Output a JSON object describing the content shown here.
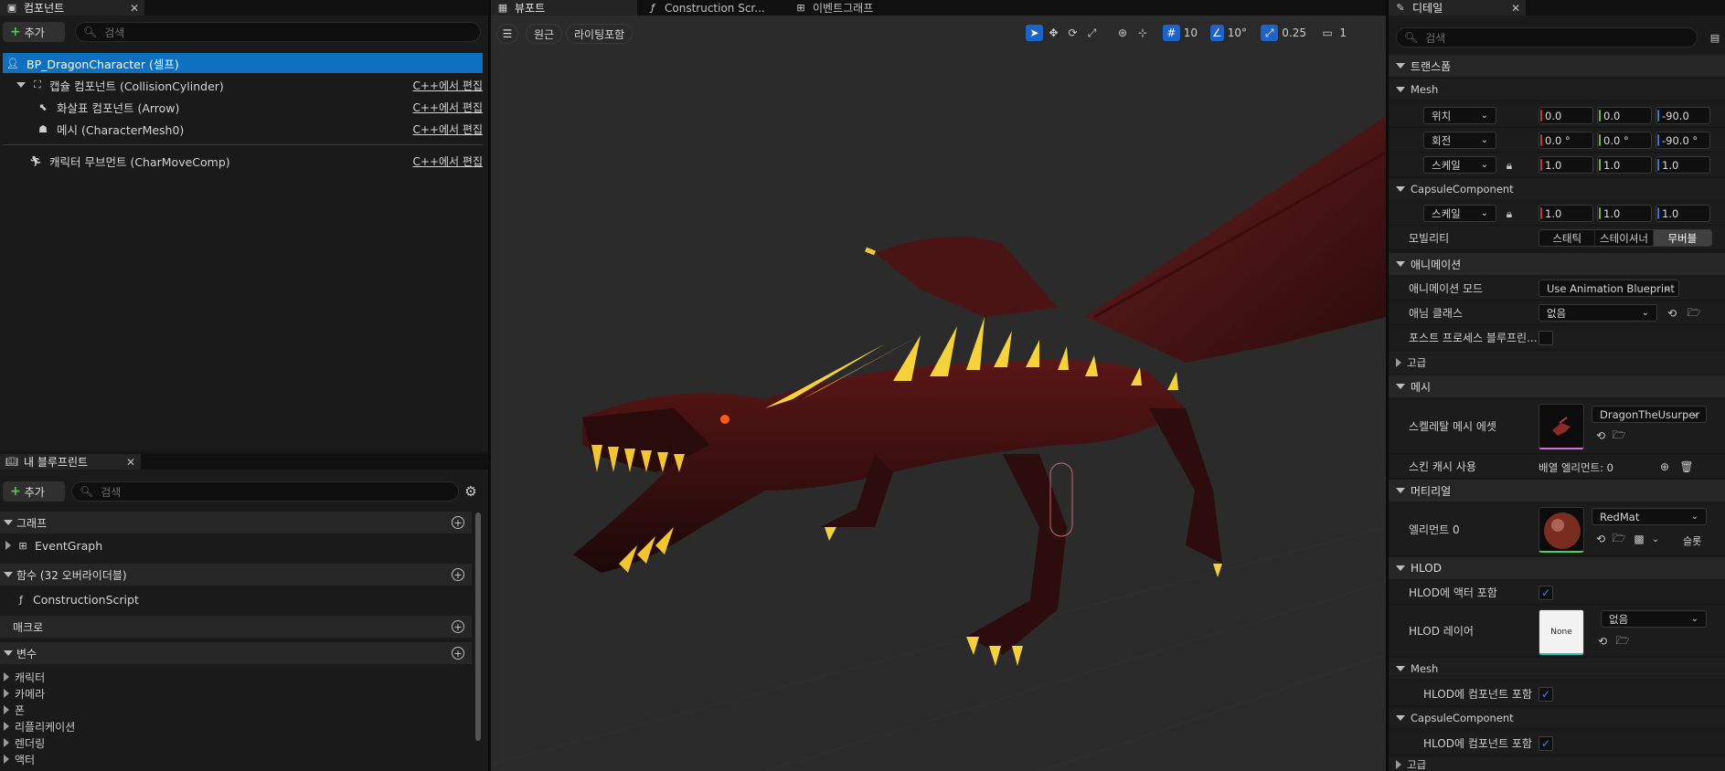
{
  "components": {
    "tab_title": "컴포넌트",
    "add_label": "추가",
    "search_placeholder": "검색",
    "root": "BP_DragonCharacter (셀프)",
    "items": [
      {
        "label": "캡슐 컴포넌트 (CollisionCylinder)",
        "edit": "C++에서 편집"
      },
      {
        "label": "화살표 컴포넌트 (Arrow)",
        "edit": "C++에서 편집"
      },
      {
        "label": "메시 (CharacterMesh0)",
        "edit": "C++에서 편집"
      },
      {
        "label": "캐릭터 무브먼트 (CharMoveComp)",
        "edit": "C++에서 편집"
      }
    ]
  },
  "my_blueprint": {
    "tab_title": "내 블루프린트",
    "add_label": "추가",
    "search_placeholder": "검색",
    "graph_header": "그래프",
    "graph_item": "EventGraph",
    "functions_header": "함수 (32 오버라이더블)",
    "function_item": "ConstructionScript",
    "macros_header": "매크로",
    "variables_header": "변수",
    "variable_categories": [
      "캐릭터",
      "카메라",
      "폰",
      "리플리케이션",
      "렌더링",
      "액터"
    ]
  },
  "viewport_tabs": {
    "viewport": "뷰포트",
    "construction": "Construction Scr...",
    "event_graph": "이벤트그래프"
  },
  "viewport_toolbar": {
    "perspective": "원근",
    "lighting": "라이팅포함",
    "grid_snap": "10",
    "rotation_snap": "10°",
    "scale_snap": "0.25",
    "camera_speed": "1"
  },
  "details": {
    "tab_title": "디테일",
    "search_placeholder": "검색",
    "transform_header": "트랜스폼",
    "mesh_sub": "Mesh",
    "location_label": "위치",
    "location": [
      "0.0",
      "0.0",
      "-90.0"
    ],
    "rotation_label": "회전",
    "rotation": [
      "0.0 °",
      "0.0 °",
      "-90.0 °"
    ],
    "scale_label": "스케일",
    "scale": [
      "1.0",
      "1.0",
      "1.0"
    ],
    "capsule_sub": "CapsuleComponent",
    "capsule_scale_label": "스케일",
    "capsule_scale": [
      "1.0",
      "1.0",
      "1.0"
    ],
    "mobility_label": "모빌리티",
    "mobility_options": [
      "스태틱",
      "스테이셔너",
      "무버블"
    ],
    "animation_header": "애니메이션",
    "anim_mode_label": "애니메이션 모드",
    "anim_mode_value": "Use Animation Blueprint",
    "anim_class_label": "애님 클래스",
    "anim_class_value": "없음",
    "post_process_label": "포스트 프로세스 블루프린...",
    "advanced_label": "고급",
    "mesh_header": "메시",
    "skeletal_mesh_label": "스켈레탈 메시 에셋",
    "skeletal_mesh_value": "DragonTheUsurper",
    "skin_cache_label": "스킨 캐시 사용",
    "skin_cache_value": "배열 엘리먼트: 0",
    "materials_header": "머티리얼",
    "element0_label": "엘리먼트 0",
    "element0_value": "RedMat",
    "slot_label": "슬롯",
    "hlod_header": "HLOD",
    "hlod_include_actor_label": "HLOD에 액터 포함",
    "hlod_layer_label": "HLOD 레이어",
    "hlod_layer_thumb": "None",
    "hlod_layer_value": "없음",
    "hlod_mesh_sub": "Mesh",
    "hlod_mesh_include_label": "HLOD에 컴포넌트 포함",
    "hlod_capsule_sub": "CapsuleComponent",
    "hlod_capsule_include_label": "HLOD에 컴포넌트 포함",
    "advanced2_label": "고급"
  },
  "colors": {
    "selection": "#0e70c0",
    "accent_blue": "#1e63c8",
    "x_axis": "#c8372d",
    "y_axis": "#7fb03a",
    "z_axis": "#2f7ad8"
  }
}
